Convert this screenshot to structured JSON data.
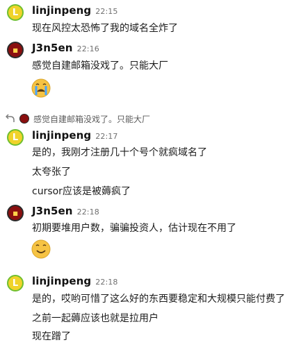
{
  "messages": [
    {
      "user": "linjinpeng",
      "time": "22:15",
      "avatar_letter": "L",
      "lines": [
        "现在风控太恐怖了我的域名全炸了"
      ]
    },
    {
      "user": "J3n5en",
      "time": "22:16",
      "avatar_letter": "",
      "lines": [
        "感觉自建邮箱没戏了。只能大厂"
      ],
      "emoji": "crying-face"
    },
    {
      "user": "linjinpeng",
      "time": "22:17",
      "avatar_letter": "L",
      "lines": [
        "是的，我刚才注册几十个号个就疯域名了",
        "太夸张了",
        "cursor应该是被薅疯了"
      ]
    },
    {
      "user": "J3n5en",
      "time": "22:18",
      "avatar_letter": "",
      "lines": [
        "初期要堆用户数，骗骗投资人，估计现在不用了"
      ],
      "emoji": "smiling-face"
    },
    {
      "user": "linjinpeng",
      "time": "22:18",
      "avatar_letter": "L",
      "lines": [
        "是的，哎哟可惜了这么好的东西要稳定和大规模只能付费了",
        "之前一起薅应该也就是拉用户",
        "现在蹭了"
      ]
    }
  ],
  "reply_preview": {
    "text": "感觉自建邮箱没戏了。只能大厂"
  },
  "colors": {
    "username": "#111111",
    "time": "#6f6f6f",
    "text": "#1c1c1c",
    "avatar_l_bg": "#f0d32a",
    "avatar_l_ring": "#6fbf2f",
    "avatar_j_bg": "#8a0f0f"
  }
}
